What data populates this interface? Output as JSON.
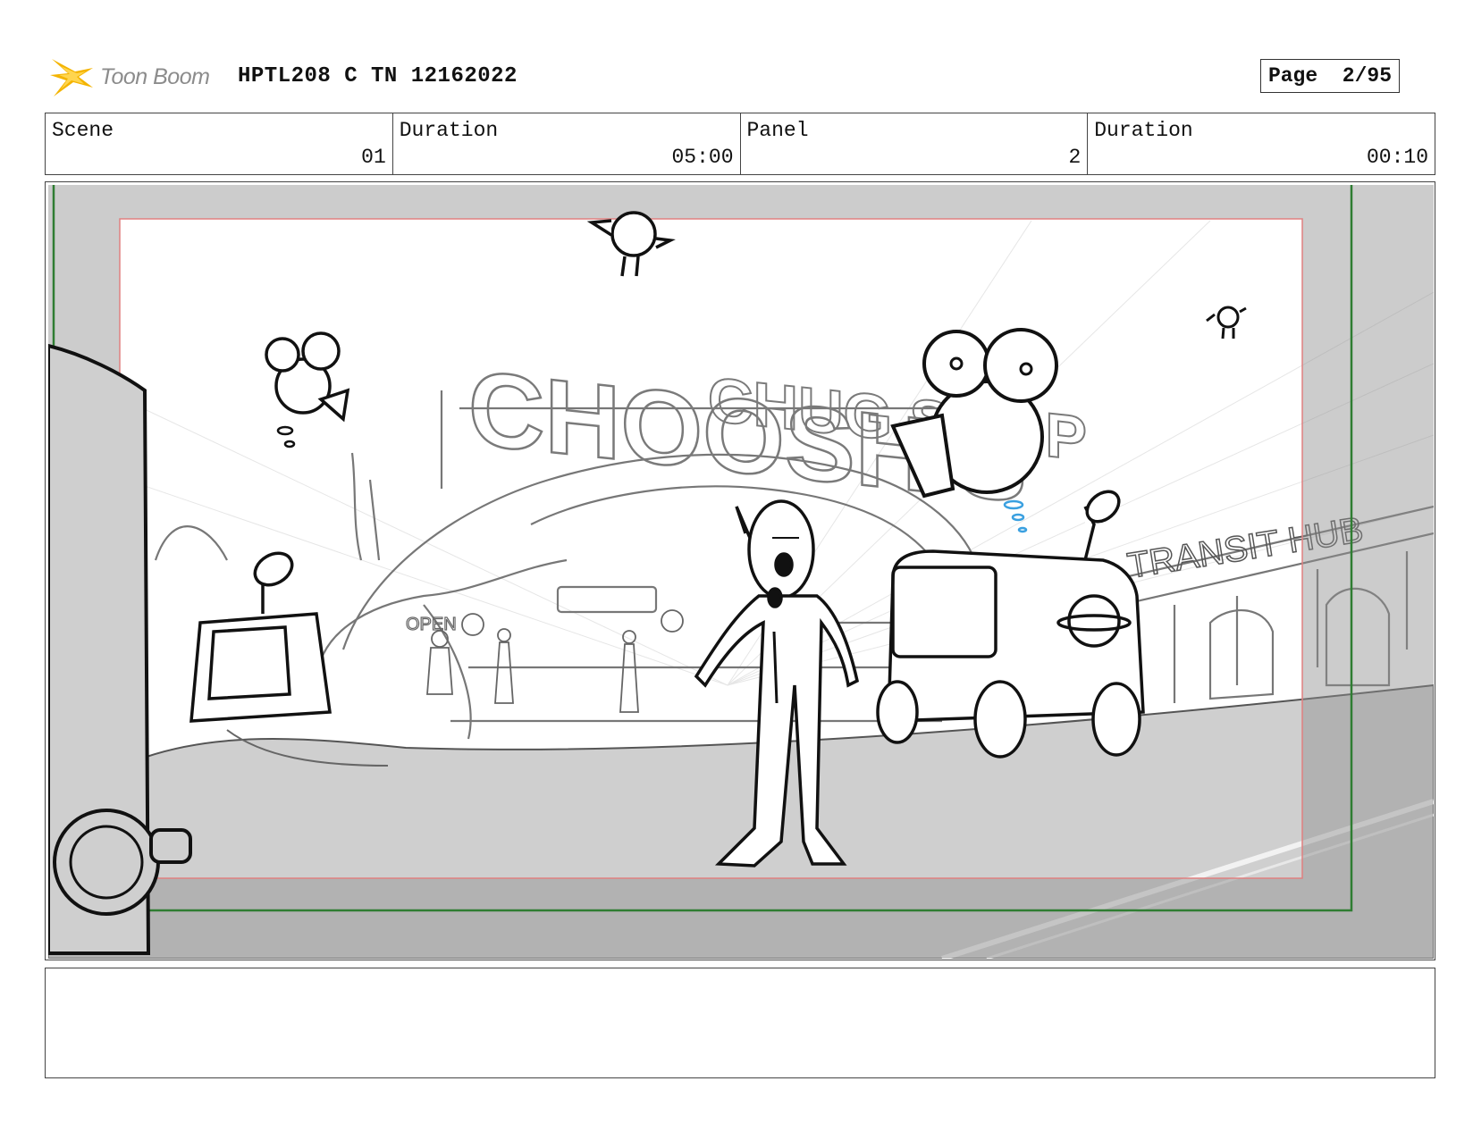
{
  "header": {
    "logo_text": "Toon Boom",
    "board_title": "HPTL208 C TN 12162022",
    "page_label": "Page",
    "page_value": "2/95"
  },
  "info": {
    "scene_label": "Scene",
    "scene_value": "01",
    "duration_label": "Duration",
    "duration_value": "05:00",
    "panel_label": "Panel",
    "panel_value": "2",
    "panel_duration_label": "Duration",
    "panel_duration_value": "00:10"
  },
  "artwork": {
    "sign_main": "CHOOSH'S",
    "sign_sub": "CHUG SHOP",
    "sign_transit": "TRANSIT HUB",
    "sign_open": "OPEN",
    "colors": {
      "safe_frame": "#2f7d32",
      "title_safe": "#e08080",
      "overlay": "#9e9e9e",
      "drip": "#3aa0e0"
    }
  },
  "notes": {
    "text": ""
  }
}
